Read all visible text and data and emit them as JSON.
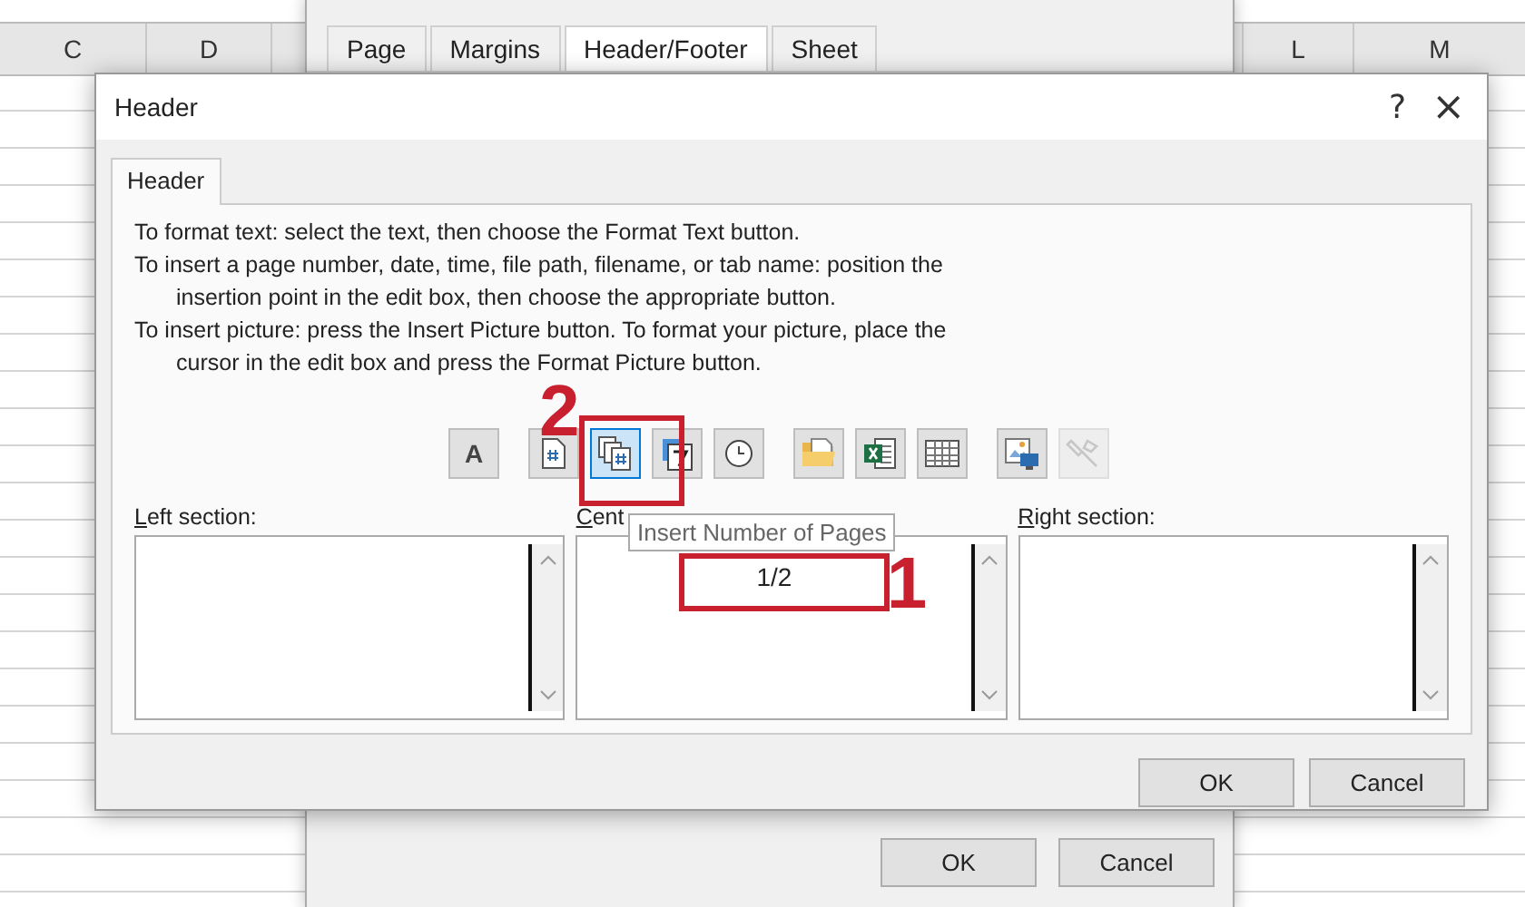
{
  "sheet": {
    "columns_left": [
      "C",
      "D"
    ],
    "columns_right": [
      "L",
      "M"
    ]
  },
  "page_setup": {
    "tabs": [
      {
        "label": "Page",
        "selected": false
      },
      {
        "label": "Margins",
        "selected": false
      },
      {
        "label": "Header/Footer",
        "selected": true
      },
      {
        "label": "Sheet",
        "selected": false
      }
    ],
    "buttons": [
      "OK",
      "Cancel"
    ]
  },
  "header_dialog": {
    "title": "Header",
    "help": "?",
    "close": "×",
    "tabs": [
      {
        "label": "Header",
        "selected": true
      }
    ],
    "instructions": [
      [
        "To format text:  select the text, then choose the Format Text button."
      ],
      [
        "To insert a page number, date, time, file path, filename, or tab name:  position the",
        "insertion point in the edit box, then choose the appropriate button."
      ],
      [
        "To insert picture: press the Insert Picture button.  To format your picture, place the",
        "cursor in the edit box and press the Format Picture button."
      ]
    ],
    "toolbar": [
      {
        "buttons": [
          {
            "kind": "text",
            "label": "A",
            "selected": false,
            "disabled": false
          }
        ]
      },
      {
        "buttons": [
          {
            "kind": "page-number",
            "selected": false,
            "disabled": false
          },
          {
            "kind": "page-count",
            "selected": true,
            "disabled": false
          },
          {
            "kind": "date",
            "selected": false,
            "disabled": false
          },
          {
            "kind": "time",
            "selected": false,
            "disabled": false
          }
        ]
      },
      {
        "buttons": [
          {
            "kind": "folder",
            "selected": false,
            "disabled": false
          },
          {
            "kind": "workbook",
            "selected": false,
            "disabled": false
          },
          {
            "kind": "sheet",
            "selected": false,
            "disabled": false
          }
        ]
      },
      {
        "buttons": [
          {
            "kind": "picture",
            "selected": false,
            "disabled": false
          },
          {
            "kind": "format-picture",
            "selected": false,
            "disabled": true
          }
        ]
      }
    ],
    "sections": [
      {
        "label": "Left section:"
      },
      {
        "label": "Cent",
        "value": "1/2"
      },
      {
        "label": "Right section:"
      }
    ],
    "tooltip": "Insert Number of Pages",
    "buttons": [
      "OK",
      "Cancel"
    ],
    "annotations": [
      {
        "label": "1"
      },
      {
        "label": "2"
      }
    ]
  }
}
